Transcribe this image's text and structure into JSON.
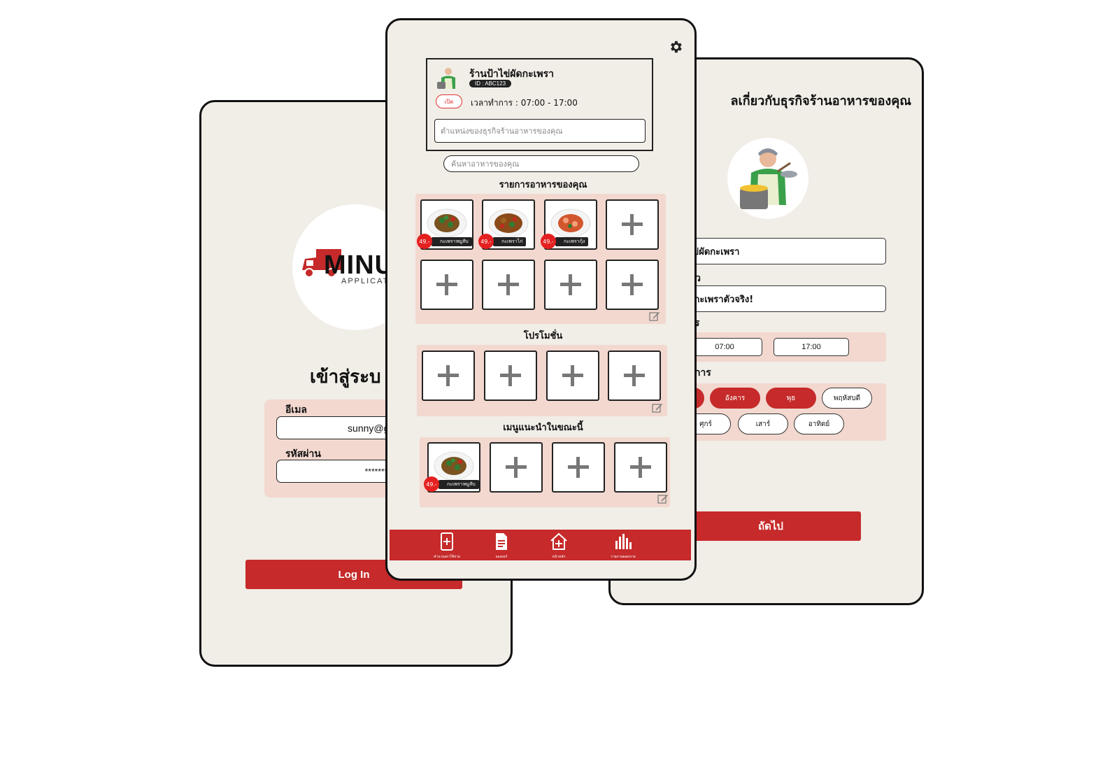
{
  "login": {
    "logo_text": "MINU",
    "logo_sub": "APPLICAT",
    "title": "เข้าสู่ระบ",
    "email_label": "อีเมล",
    "email_value": "sunny@gmail.c",
    "password_label": "รหัสผ่าน",
    "password_value": "**********",
    "login_button": "Log In"
  },
  "profile": {
    "heading": "ลเกี่ยวกับธุรกิจร้านอาหารของคุณ",
    "shop_name_value": "ใข่ผัดกะเพรา",
    "intro_label": "ตัว",
    "intro_value": "ดกะเพราตัวจริง!",
    "hours_label": "าร",
    "open_time": "07:00",
    "close_time": "17:00",
    "days_label": "าการ",
    "days": [
      {
        "label": "",
        "active": true
      },
      {
        "label": "อังคาร",
        "active": true
      },
      {
        "label": "พุธ",
        "active": true
      },
      {
        "label": "พฤหัสบดี",
        "active": false
      },
      {
        "label": "ศุกร์",
        "active": false
      },
      {
        "label": "เสาร์",
        "active": false
      },
      {
        "label": "อาทิตย์",
        "active": false
      }
    ],
    "next_button": "ถัดไป"
  },
  "main": {
    "shop_name": "ร้านป้าไข่ผัดกะเพรา",
    "shop_id": "ID : ABC123",
    "open_badge": "เปิด",
    "hours_text": "เวลาทำการ : 07:00 - 17:00",
    "location_placeholder": "ตำแหน่งของธุรกิจร้านอาหารของคุณ",
    "search_placeholder": "ค้นหาอาหารของคุณ",
    "menu_section_title": "รายการอาหารของคุณ",
    "menu_items": [
      {
        "name": "กะเพราหมูสับ",
        "price": "49.-"
      },
      {
        "name": "กะเพราไก่",
        "price": "49.-"
      },
      {
        "name": "กะเพรากุ้ง",
        "price": "49.-"
      }
    ],
    "promo_section_title": "โปรโมชั่น",
    "recommend_section_title": "เมนูแนะนำในขณะนี้",
    "recommend_items": [
      {
        "name": "กะเพราหมูสับ",
        "price": "49.-"
      }
    ],
    "nav": [
      {
        "label": "คำนวณค่าใช้จ่าย",
        "icon": "phone-plus-icon"
      },
      {
        "label": "ออเดอร์",
        "icon": "document-icon"
      },
      {
        "label": "หน้าหลัก",
        "icon": "home-plus-icon"
      },
      {
        "label": "รายงานยอดขาย",
        "icon": "bar-chart-icon"
      }
    ]
  }
}
